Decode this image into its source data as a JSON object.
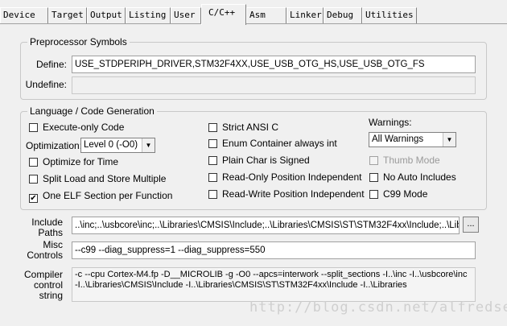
{
  "tabs": [
    {
      "label": "Device",
      "active": false
    },
    {
      "label": "Target",
      "active": false
    },
    {
      "label": "Output",
      "active": false
    },
    {
      "label": "Listing",
      "active": false
    },
    {
      "label": "User",
      "active": false
    },
    {
      "label": "C/C++",
      "active": true
    },
    {
      "label": "Asm",
      "active": false
    },
    {
      "label": "Linker",
      "active": false
    },
    {
      "label": "Debug",
      "active": false
    },
    {
      "label": "Utilities",
      "active": false
    }
  ],
  "preprocessor": {
    "title": "Preprocessor Symbols",
    "define_label": "Define:",
    "define_value": "USE_STDPERIPH_DRIVER,STM32F4XX,USE_USB_OTG_HS,USE_USB_OTG_FS",
    "undefine_label": "Undefine:",
    "undefine_value": ""
  },
  "language": {
    "title": "Language / Code Generation",
    "execute_only": {
      "label": "Execute-only Code",
      "checked": false
    },
    "optimization_label": "Optimization:",
    "optimization_value": "Level 0 (-O0)",
    "optimize_time": {
      "label": "Optimize for Time",
      "checked": false
    },
    "split_load": {
      "label": "Split Load and Store Multiple",
      "checked": false
    },
    "one_elf": {
      "label": "One ELF Section per Function",
      "checked": true
    },
    "strict_ansi": {
      "label": "Strict ANSI C",
      "checked": false
    },
    "enum_container": {
      "label": "Enum Container always int",
      "checked": false
    },
    "plain_char": {
      "label": "Plain Char is Signed",
      "checked": false
    },
    "readonly_pi": {
      "label": "Read-Only Position Independent",
      "checked": false
    },
    "readwrite_pi": {
      "label": "Read-Write Position Independent",
      "checked": false
    },
    "warnings_label": "Warnings:",
    "warnings_value": "All Warnings",
    "thumb_mode": {
      "label": "Thumb Mode",
      "checked": false,
      "disabled": true
    },
    "no_auto_includes": {
      "label": "No Auto Includes",
      "checked": false
    },
    "c99_mode": {
      "label": "C99 Mode",
      "checked": false
    }
  },
  "include_paths": {
    "label_line1": "Include",
    "label_line2": "Paths",
    "value": "..\\inc;..\\usbcore\\inc;..\\Libraries\\CMSIS\\Include;..\\Libraries\\CMSIS\\ST\\STM32F4xx\\Include;..\\Librar",
    "browse_label": "..."
  },
  "misc_controls": {
    "label_line1": "Misc",
    "label_line2": "Controls",
    "value": "--c99 --diag_suppress=1 --diag_suppress=550"
  },
  "compiler_control": {
    "label_line1": "Compiler",
    "label_line2": "control",
    "label_line3": "string",
    "line1": "-c --cpu Cortex-M4.fp -D__MICROLIB -g -O0 --apcs=interwork --split_sections -I..\\inc -I..\\usbcore\\inc",
    "line2": "-I..\\Libraries\\CMSIS\\Include -I..\\Libraries\\CMSIS\\ST\\STM32F4xx\\Include -I..\\Libraries"
  },
  "watermark": "http://blog.csdn.net/alfredseng"
}
